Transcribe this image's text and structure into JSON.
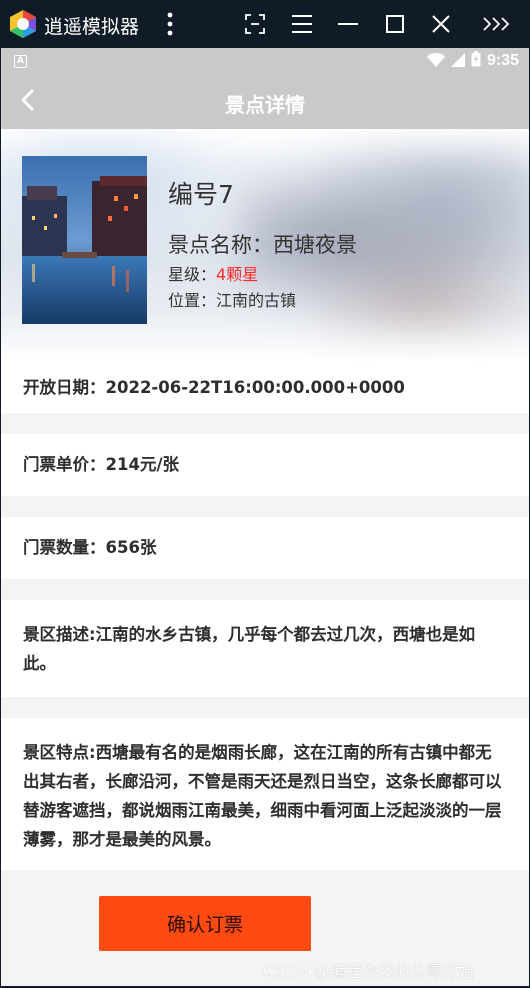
{
  "emulator": {
    "title": "逍遥模拟器",
    "icons": [
      "more-vertical-icon",
      "screenshot-icon",
      "menu-icon",
      "minimize-icon",
      "maximize-icon",
      "close-icon",
      "expand-icon"
    ]
  },
  "status_bar": {
    "time": "9:35",
    "notification_letter": "A"
  },
  "app_bar": {
    "title": "景点详情"
  },
  "spot": {
    "number_label": "编号7",
    "name_label": "景点名称：",
    "name": "西塘夜景",
    "star_label": "星级：",
    "star_value": "4颗星",
    "location_label": "位置：",
    "location": "江南的古镇"
  },
  "details": {
    "open_date": "开放日期：2022-06-22T16:00:00.000+0000",
    "ticket_price": "门票单价：214元/张",
    "ticket_count": "门票数量：656张",
    "description": "景区描述:江南的水乡古镇，几乎每个都去过几次，西塘也是如此。",
    "features": "景区特点:西塘最有名的是烟雨长廊，这在江南的所有古镇中都无出其右者，长廊沿河，不管是雨天还是烈日当空，这条长廊都可以替游客遮挡，都说烟雨江南最美，细雨中看河面上泛起淡淡的一层薄雾，那才是最美的风景。"
  },
  "actions": {
    "confirm": "确认订票"
  },
  "watermark": "CSDN @编程你我他从零开始",
  "colors": {
    "accent_button": "#ff4a12",
    "star_red": "#ff2a2a",
    "app_bar": "#c9c9c9"
  }
}
